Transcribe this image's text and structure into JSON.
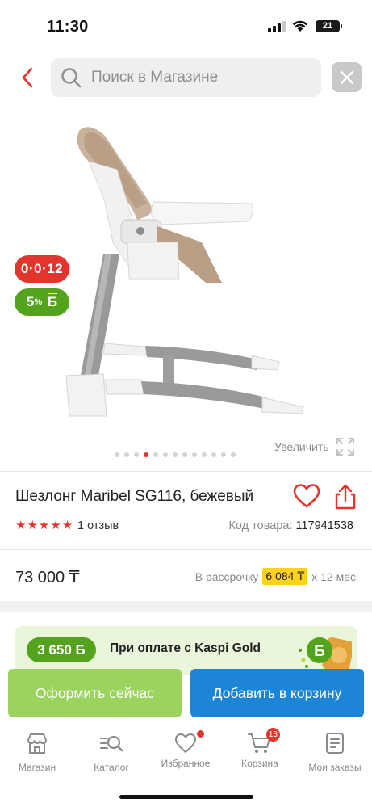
{
  "status_bar": {
    "time": "11:30",
    "battery": "21"
  },
  "search": {
    "placeholder": "Поиск в Магазине"
  },
  "badges": {
    "credit": "0·0·12",
    "bonus_value": "5",
    "bonus_sup": "%",
    "bonus_currency": "Б"
  },
  "gallery": {
    "zoom_label": "Увеличить",
    "dot_count": 13,
    "active_index": 3
  },
  "product": {
    "title": "Шезлонг Maribel SG116, бежевый",
    "rating": 5,
    "reviews": "1 отзыв",
    "sku_label": "Код товара:",
    "sku_value": "117941538",
    "price": "73 000 ₸",
    "installment_label": "В рассрочку",
    "installment_amount": "6 084 ₸",
    "installment_term": "x 12 мес"
  },
  "promo": {
    "bonus": "3 650 Б",
    "text": "При оплате с Kaspi Gold",
    "coin_letter": "Б"
  },
  "actions": {
    "order": "Оформить сейчас",
    "add_to_cart": "Добавить в корзину"
  },
  "nav": {
    "items": [
      {
        "label": "Магазин",
        "icon": "store-icon"
      },
      {
        "label": "Каталог",
        "icon": "catalog-search-icon"
      },
      {
        "label": "Избранное",
        "icon": "heart-icon"
      },
      {
        "label": "Корзина",
        "icon": "cart-icon",
        "count": "13"
      },
      {
        "label": "Мои заказы",
        "icon": "orders-icon"
      }
    ]
  },
  "colors": {
    "accent_red": "#e2352d",
    "green": "#53a31c",
    "blue": "#1d85d6",
    "light_green": "#9ad45e",
    "yellow": "#ffd21f"
  }
}
